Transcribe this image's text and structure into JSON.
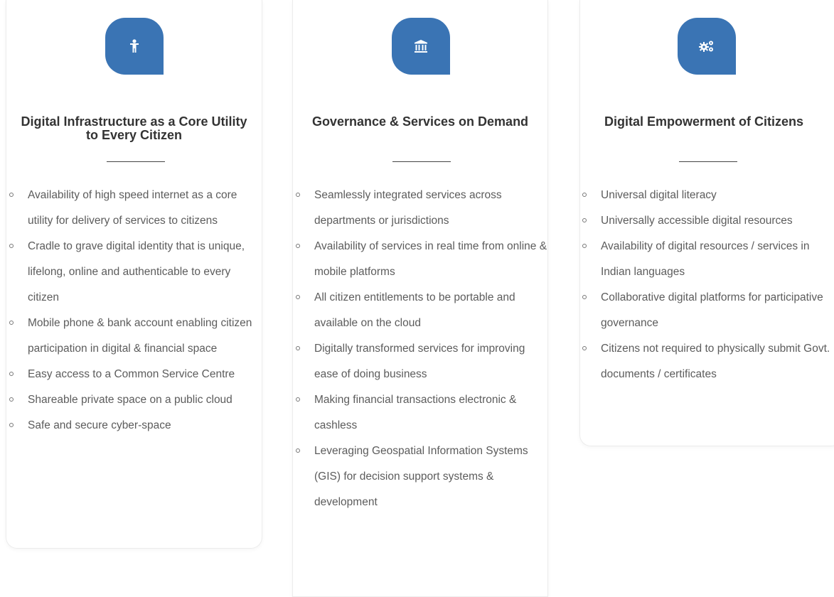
{
  "colors": {
    "accent": "#3a74b4",
    "text": "#5c5c5c",
    "heading": "#333333"
  },
  "cards": [
    {
      "icon": "person-icon",
      "title": "Digital Infrastructure as a Core Utility to Every Citizen",
      "items": [
        "Availability of high speed internet as a core utility for delivery of services to citizens",
        "Cradle to grave digital identity that is unique, lifelong, online and authenticable to every citizen",
        "Mobile phone & bank account enabling citizen participation in digital & financial space",
        "Easy access to a Common Service Centre",
        "Shareable private space on a public cloud",
        "Safe and secure cyber-space"
      ]
    },
    {
      "icon": "bank-building-icon",
      "title": "Governance & Services on Demand",
      "items": [
        "Seamlessly integrated services across departments or jurisdictions",
        "Availability of services in real time from online & mobile platforms",
        "All citizen entitlements to be portable and available on the cloud",
        "Digitally transformed services for improving ease of doing business",
        "Making financial transactions electronic & cashless",
        "Leveraging Geospatial Information Systems (GIS) for decision support systems & development"
      ]
    },
    {
      "icon": "gears-icon",
      "title": "Digital Empowerment of Citizens",
      "items": [
        "Universal digital literacy",
        "Universally accessible digital resources",
        "Availability of digital resources / services in Indian languages",
        "Collaborative digital platforms for participative governance",
        "Citizens not required to physically submit Govt. documents / certificates"
      ]
    }
  ]
}
